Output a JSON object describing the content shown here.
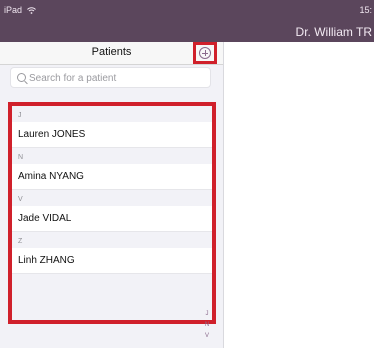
{
  "status": {
    "device": "iPad",
    "time": "15:"
  },
  "header": {
    "title": "Dr. William TR"
  },
  "patients": {
    "title": "Patients",
    "search_placeholder": "Search for a patient",
    "sections": [
      {
        "letter": "J",
        "name": "Lauren JONES"
      },
      {
        "letter": "N",
        "name": "Amina NYANG"
      },
      {
        "letter": "V",
        "name": "Jade VIDAL"
      },
      {
        "letter": "Z",
        "name": "Linh ZHANG"
      }
    ],
    "index": [
      "J",
      "N",
      "V"
    ]
  },
  "colors": {
    "header": "#5b465c",
    "highlight": "#d0202b",
    "accent": "#8a6a8c"
  },
  "icons": {
    "add": "plus-circle-icon",
    "search": "magnifier-icon",
    "wifi": "wifi-icon"
  }
}
